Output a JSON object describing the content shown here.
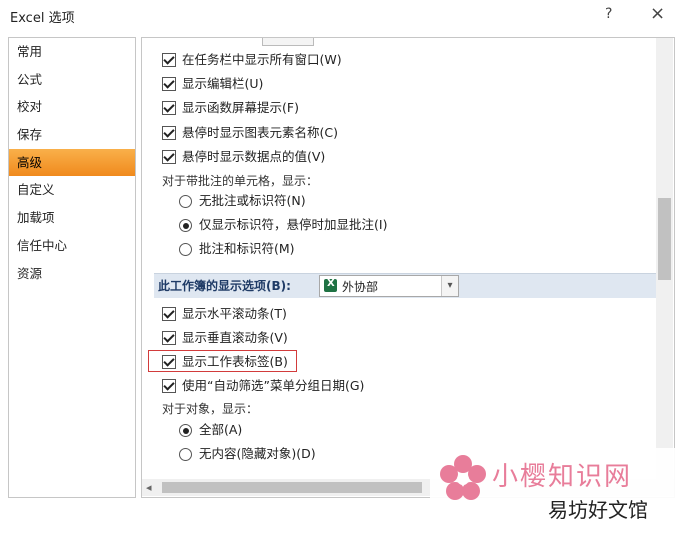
{
  "window": {
    "title": "Excel 选项",
    "help": "?",
    "close": "×"
  },
  "nav": {
    "items": [
      {
        "label": "常用",
        "active": false
      },
      {
        "label": "公式",
        "active": false
      },
      {
        "label": "校对",
        "active": false
      },
      {
        "label": "保存",
        "active": false
      },
      {
        "label": "高级",
        "active": true
      },
      {
        "label": "自定义",
        "active": false
      },
      {
        "label": "加载项",
        "active": false
      },
      {
        "label": "信任中心",
        "active": false
      },
      {
        "label": "资源",
        "active": false
      }
    ]
  },
  "display": {
    "taskbar_all_windows": "在任务栏中显示所有窗口(W)",
    "show_formula_bar": "显示编辑栏(U)",
    "show_function_screentips": "显示函数屏幕提示(F)",
    "hover_chart_element_names": "悬停时显示图表元素名称(C)",
    "hover_data_point_values": "悬停时显示数据点的值(V)",
    "comments_heading": "对于带批注的单元格，显示：",
    "comments_options": [
      {
        "label": "无批注或标识符(N)",
        "selected": false
      },
      {
        "label": "仅显示标识符，悬停时加显批注(I)",
        "selected": true
      },
      {
        "label": "批注和标识符(M)",
        "selected": false
      }
    ]
  },
  "workbook_section": {
    "label": "此工作簿的显示选项(B):",
    "selected_workbook": "外协部",
    "show_horizontal_scroll": "显示水平滚动条(T)",
    "show_vertical_scroll": "显示垂直滚动条(V)",
    "show_sheet_tabs": "显示工作表标签(B)",
    "group_dates_autofilter": "使用“自动筛选”菜单分组日期(G)",
    "objects_heading": "对于对象，显示：",
    "objects_options": [
      {
        "label": "全部(A)",
        "selected": true
      },
      {
        "label": "无内容(隐藏对象)(D)",
        "selected": false
      }
    ]
  },
  "watermark": {
    "line1": "小樱知识网",
    "line2": "易坊好文馆"
  },
  "colors": {
    "active_nav": "#f08a1d",
    "highlight_box": "#d23b3b",
    "section_bg": "#dfe7f1"
  }
}
